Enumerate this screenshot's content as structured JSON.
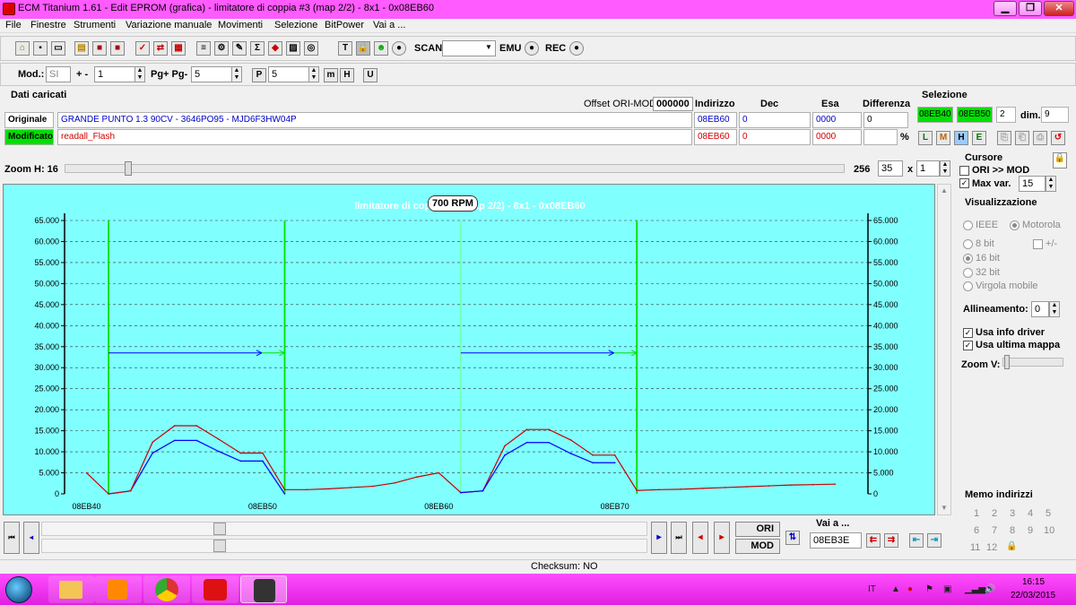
{
  "window": {
    "title": "ECM Titanium 1.61 - Edit EPROM (grafica) - limitatore di coppia #3 (map 2/2) - 8x1 - 0x08EB60",
    "min": "▁",
    "max": "❐",
    "close": "✕"
  },
  "menu": [
    "File",
    "Finestre",
    "Strumenti",
    "Variazione manuale",
    "Movimenti",
    "Selezione",
    "BitPower",
    "Vai a ..."
  ],
  "toolbar1": {
    "scan_label": "SCAN",
    "scan_value": "",
    "emu_label": "EMU",
    "rec_label": "REC"
  },
  "toolbar2": {
    "mod_label": "Mod.:",
    "mod_value": "SI",
    "plusminus_label": "+ -",
    "plusminus_value": "1",
    "pg_label": "Pg+ Pg-",
    "pg_value": "5",
    "p_value": "5"
  },
  "dati": {
    "section_title": "Dati caricati",
    "offset_label": "Offset ORI-MOD",
    "offset_value": "000000",
    "col_indirizzo": "Indirizzo",
    "col_dec": "Dec",
    "col_esa": "Esa",
    "col_diff": "Differenza",
    "originale_label": "Originale",
    "originale_name": "GRANDE PUNTO 1.3 90CV - 3646PO95 - MJD6F3HW04P",
    "originale_addr": "08EB60",
    "originale_dec": "0",
    "originale_esa": "0000",
    "originale_diff": "0",
    "modificato_label": "Modificato",
    "modificato_name": "readall_Flash",
    "modificato_addr": "08EB60",
    "modificato_dec": "0",
    "modificato_esa": "0000",
    "modificato_diff": "",
    "percent": "%"
  },
  "selezione": {
    "title": "Selezione",
    "from": "08EB40",
    "to": "08EB50",
    "count": "2",
    "dim_label": "dim.",
    "dim_value": "9"
  },
  "zoom": {
    "label": "Zoom H: 16",
    "max": "256",
    "value": "35",
    "x": "x",
    "mult": "1"
  },
  "cursore": {
    "title": "Cursore",
    "ori_mod": "ORI >> MOD",
    "ori_mod_checked": false,
    "max_var_label": "Max var.",
    "max_var_checked": true,
    "max_var_value": "15"
  },
  "visualizzazione": {
    "title": "Visualizzazione",
    "ieee": "IEEE",
    "motorola": "Motorola",
    "bit8": "8 bit",
    "plusminus": "+/-",
    "bit16": "16 bit",
    "bit32": "32 bit",
    "virgola": "Virgola mobile",
    "allineamento_label": "Allineamento:",
    "allineamento_value": "0",
    "usa_info": "Usa info driver",
    "usa_ultima": "Usa ultima mappa",
    "zoomv": "Zoom V:"
  },
  "memo": {
    "title": "Memo indirizzi",
    "numbers": [
      "1",
      "2",
      "3",
      "4",
      "5",
      "6",
      "7",
      "8",
      "9",
      "10",
      "11",
      "12"
    ]
  },
  "bottom": {
    "ori": "ORI",
    "mod": "MOD",
    "vai_label": "Vai a ...",
    "vai_value": "08EB3E",
    "checksum": "Checksum: NO"
  },
  "taskbar": {
    "lang": "IT",
    "time": "16:15",
    "date": "22/03/2015"
  },
  "colors": {
    "chart_bg": "#80ffff",
    "ori_line": "#0000ff",
    "mod_line": "#c80000",
    "marker": "#00e000",
    "selected_green": "#00e000"
  },
  "chart_data": {
    "type": "line",
    "title": "limitatore di coppia #3 (map 2/2) - 8x1 - 0x08EB60",
    "tooltip": "700 RPM",
    "y_ticks": [
      "0",
      "5.000",
      "10.000",
      "15.000",
      "20.000",
      "25.000",
      "30.000",
      "35.000",
      "40.000",
      "45.000",
      "50.000",
      "55.000",
      "60.000",
      "65.000"
    ],
    "ylim": [
      0,
      65000
    ],
    "x_labels": [
      "08EB40",
      "08EB50",
      "08EB60",
      "08EB70"
    ],
    "x_label_index": [
      0,
      16,
      32,
      48
    ],
    "xlim": [
      -2,
      71
    ],
    "series": [
      {
        "color": "#0000ff",
        "x": [
          2,
          4,
          6,
          8,
          10,
          12,
          14,
          16,
          18
        ],
        "values": [
          0,
          700,
          9700,
          12700,
          12700,
          10100,
          7800,
          7800,
          0
        ]
      },
      {
        "color": "#c80000",
        "x": [
          0,
          2,
          4,
          6,
          8,
          10,
          12,
          14,
          16,
          18,
          20,
          22,
          24,
          26,
          28,
          30,
          32,
          34,
          36,
          38,
          40,
          42,
          44,
          46,
          48,
          50,
          52,
          54,
          56,
          58,
          60,
          62,
          64,
          66,
          68
        ],
        "values": [
          5000,
          0,
          700,
          12300,
          16200,
          16200,
          13000,
          9700,
          9700,
          1000,
          1000,
          1200,
          1500,
          1800,
          2600,
          4000,
          5000,
          300,
          700,
          11400,
          15300,
          15300,
          12800,
          9200,
          9200,
          800,
          1000,
          1100,
          1300,
          1500,
          1700,
          1900,
          2100,
          2200,
          2300
        ]
      },
      {
        "color": "#0000ff",
        "x": [
          34,
          36,
          38,
          40,
          42,
          44,
          46,
          48
        ],
        "values": [
          300,
          700,
          9200,
          12200,
          12200,
          9600,
          7400,
          7400
        ]
      }
    ],
    "markers": [
      {
        "x": 2,
        "label": ""
      },
      {
        "x": 18,
        "label": ""
      },
      {
        "x": 34,
        "label": ""
      },
      {
        "x": 50,
        "label": ""
      }
    ],
    "arrows_y": 33500
  }
}
